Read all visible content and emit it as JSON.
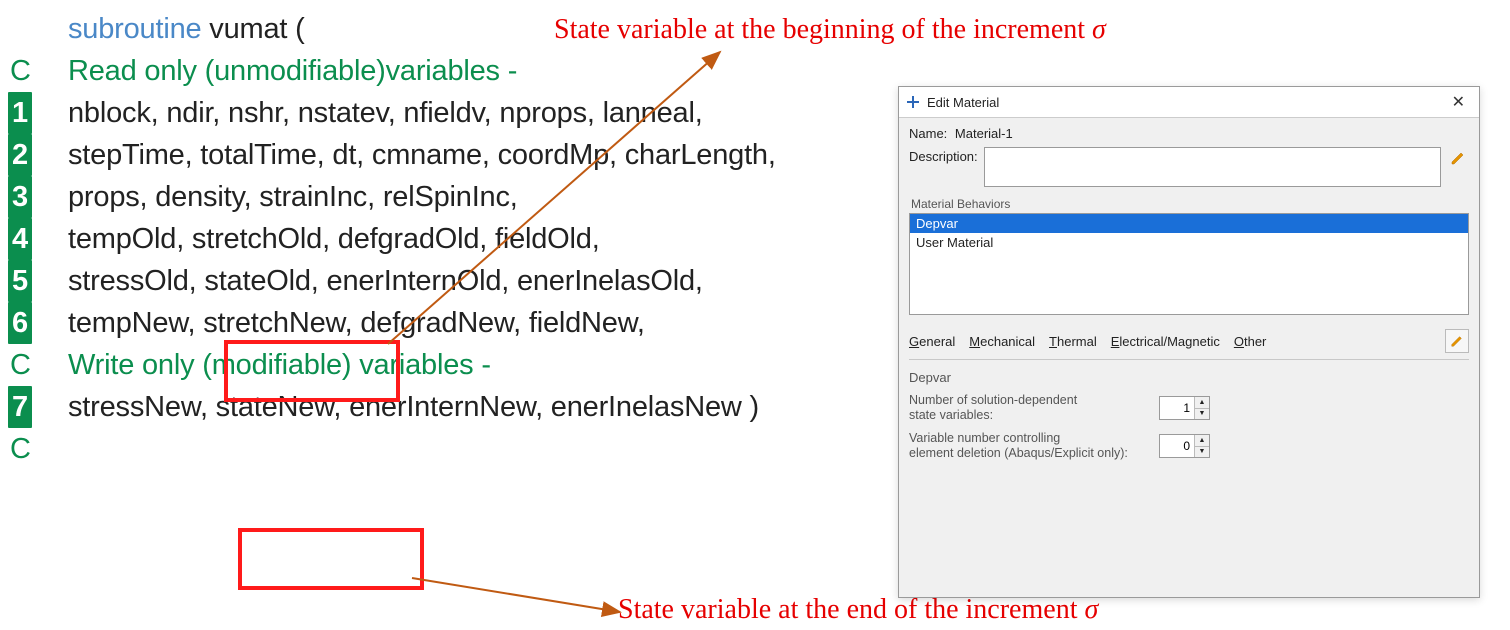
{
  "code": {
    "kw_subroutine": "subroutine",
    "func_name": " vumat (",
    "comment_read": "Read only (unmodifiable)variables -",
    "comment_write": "Write only (modifiable) variables -",
    "lines": {
      "l1": "nblock, ndir, nshr, nstatev, nfieldv, nprops, lanneal,",
      "l2": "stepTime, totalTime, dt, cmname, coordMp, charLength,",
      "l3": "props, density, strainInc, relSpinInc,",
      "l4": "tempOld, stretchOld, defgradOld, fieldOld,",
      "l5_pre": "stressOld, ",
      "l5_hl": "stateOld,",
      "l5_post": " enerInternOld, enerInelasOld,",
      "l6": "tempNew, stretchNew, defgradNew, fieldNew,",
      "l7_pre": "stressNew, ",
      "l7_hl": "stateNew,",
      "l7_post": " enerInternNew, enerInelasNew )"
    },
    "num1": "1",
    "num2": "2",
    "num3": "3",
    "num4": "4",
    "num5": "5",
    "num6": "6",
    "num7": "7",
    "c_marker": "C"
  },
  "annotations": {
    "top": "State variable at the beginning of the increment ",
    "bottom": "State variable at the end of the increment ",
    "sigma": "σ"
  },
  "dialog": {
    "title": "Edit Material",
    "name_label": "Name:",
    "name_value": "Material-1",
    "desc_label": "Description:",
    "behaviors_label": "Material Behaviors",
    "list": {
      "depvar": "Depvar",
      "user_material": "User Material"
    },
    "menu": {
      "general_ul": "G",
      "general_rest": "eneral",
      "mechanical_ul": "M",
      "mechanical_rest": "echanical",
      "thermal_ul": "T",
      "thermal_rest": "hermal",
      "elecmag_ul": "E",
      "elecmag_rest": "lectrical/Magnetic",
      "other_ul": "O",
      "other_rest": "ther"
    },
    "depvar_heading": "Depvar",
    "num_sdv_label": "Number of solution-dependent\nstate variables:",
    "num_sdv_value": "1",
    "elem_del_label": "Variable number controlling\nelement deletion (Abaqus/Explicit only):",
    "elem_del_value": "0"
  }
}
